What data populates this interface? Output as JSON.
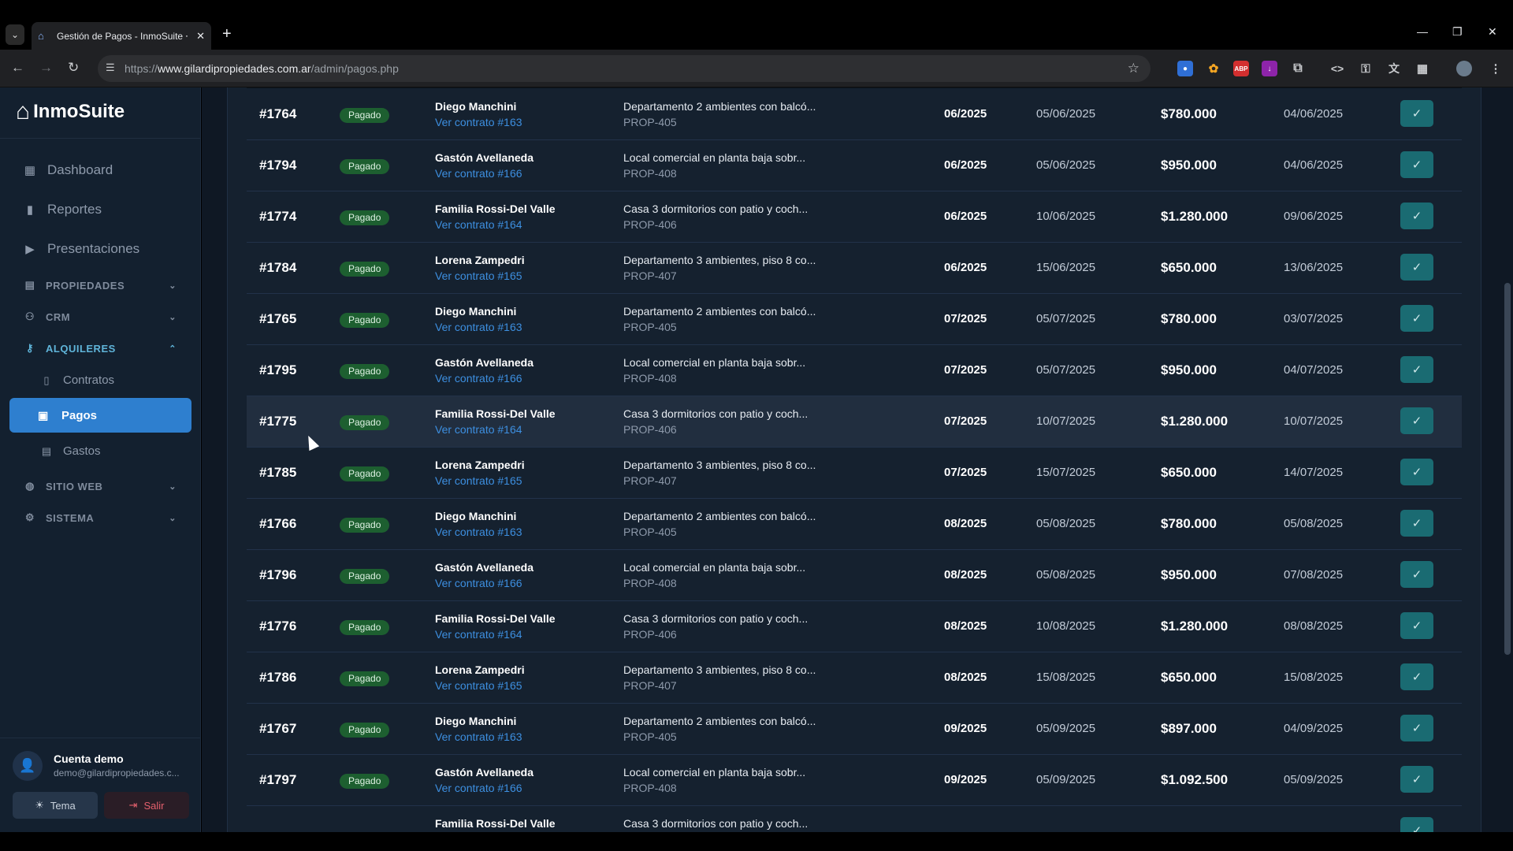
{
  "browser": {
    "tab_title": "Gestión de Pagos - InmoSuite ⸱",
    "url_scheme": "https://",
    "url_host": "www.gilardipropiedades.com.ar",
    "url_path": "/admin/pagos.php",
    "extensions": [
      "ABP"
    ]
  },
  "sidebar": {
    "brand": "InmoSuite",
    "nav": [
      {
        "label": "Dashboard",
        "icon": "grid-icon"
      },
      {
        "label": "Reportes",
        "icon": "bar-chart-icon"
      },
      {
        "label": "Presentaciones",
        "icon": "play-square-icon"
      }
    ],
    "groups": {
      "propiedades": "PROPIEDADES",
      "crm": "CRM",
      "alquileres": "ALQUILERES",
      "sitio_web": "SITIO WEB",
      "sistema": "SISTEMA"
    },
    "sub": {
      "contratos": "Contratos",
      "pagos": "Pagos",
      "gastos": "Gastos"
    },
    "user": {
      "name": "Cuenta demo",
      "email": "demo@gilardipropiedades.c..."
    },
    "buttons": {
      "tema": "Tema",
      "salir": "Salir"
    }
  },
  "payments": [
    {
      "id": "#1764",
      "status": "Pagado",
      "tenant": "Diego Manchini",
      "contract": "Ver contrato #163",
      "property": "Departamento 2 ambientes con balcó...",
      "code": "PROP-405",
      "period": "06/2025",
      "due": "05/06/2025",
      "amount": "$780.000",
      "paid": "04/06/2025"
    },
    {
      "id": "#1794",
      "status": "Pagado",
      "tenant": "Gastón Avellaneda",
      "contract": "Ver contrato #166",
      "property": "Local comercial en planta baja sobr...",
      "code": "PROP-408",
      "period": "06/2025",
      "due": "05/06/2025",
      "amount": "$950.000",
      "paid": "04/06/2025"
    },
    {
      "id": "#1774",
      "status": "Pagado",
      "tenant": "Familia Rossi-Del Valle",
      "contract": "Ver contrato #164",
      "property": "Casa 3 dormitorios con patio y coch...",
      "code": "PROP-406",
      "period": "06/2025",
      "due": "10/06/2025",
      "amount": "$1.280.000",
      "paid": "09/06/2025"
    },
    {
      "id": "#1784",
      "status": "Pagado",
      "tenant": "Lorena Zampedri",
      "contract": "Ver contrato #165",
      "property": "Departamento 3 ambientes, piso 8 co...",
      "code": "PROP-407",
      "period": "06/2025",
      "due": "15/06/2025",
      "amount": "$650.000",
      "paid": "13/06/2025"
    },
    {
      "id": "#1765",
      "status": "Pagado",
      "tenant": "Diego Manchini",
      "contract": "Ver contrato #163",
      "property": "Departamento 2 ambientes con balcó...",
      "code": "PROP-405",
      "period": "07/2025",
      "due": "05/07/2025",
      "amount": "$780.000",
      "paid": "03/07/2025"
    },
    {
      "id": "#1795",
      "status": "Pagado",
      "tenant": "Gastón Avellaneda",
      "contract": "Ver contrato #166",
      "property": "Local comercial en planta baja sobr...",
      "code": "PROP-408",
      "period": "07/2025",
      "due": "05/07/2025",
      "amount": "$950.000",
      "paid": "04/07/2025"
    },
    {
      "id": "#1775",
      "status": "Pagado",
      "tenant": "Familia Rossi-Del Valle",
      "contract": "Ver contrato #164",
      "property": "Casa 3 dormitorios con patio y coch...",
      "code": "PROP-406",
      "period": "07/2025",
      "due": "10/07/2025",
      "amount": "$1.280.000",
      "paid": "10/07/2025"
    },
    {
      "id": "#1785",
      "status": "Pagado",
      "tenant": "Lorena Zampedri",
      "contract": "Ver contrato #165",
      "property": "Departamento 3 ambientes, piso 8 co...",
      "code": "PROP-407",
      "period": "07/2025",
      "due": "15/07/2025",
      "amount": "$650.000",
      "paid": "14/07/2025"
    },
    {
      "id": "#1766",
      "status": "Pagado",
      "tenant": "Diego Manchini",
      "contract": "Ver contrato #163",
      "property": "Departamento 2 ambientes con balcó...",
      "code": "PROP-405",
      "period": "08/2025",
      "due": "05/08/2025",
      "amount": "$780.000",
      "paid": "05/08/2025"
    },
    {
      "id": "#1796",
      "status": "Pagado",
      "tenant": "Gastón Avellaneda",
      "contract": "Ver contrato #166",
      "property": "Local comercial en planta baja sobr...",
      "code": "PROP-408",
      "period": "08/2025",
      "due": "05/08/2025",
      "amount": "$950.000",
      "paid": "07/08/2025"
    },
    {
      "id": "#1776",
      "status": "Pagado",
      "tenant": "Familia Rossi-Del Valle",
      "contract": "Ver contrato #164",
      "property": "Casa 3 dormitorios con patio y coch...",
      "code": "PROP-406",
      "period": "08/2025",
      "due": "10/08/2025",
      "amount": "$1.280.000",
      "paid": "08/08/2025"
    },
    {
      "id": "#1786",
      "status": "Pagado",
      "tenant": "Lorena Zampedri",
      "contract": "Ver contrato #165",
      "property": "Departamento 3 ambientes, piso 8 co...",
      "code": "PROP-407",
      "period": "08/2025",
      "due": "15/08/2025",
      "amount": "$650.000",
      "paid": "15/08/2025"
    },
    {
      "id": "#1767",
      "status": "Pagado",
      "tenant": "Diego Manchini",
      "contract": "Ver contrato #163",
      "property": "Departamento 2 ambientes con balcó...",
      "code": "PROP-405",
      "period": "09/2025",
      "due": "05/09/2025",
      "amount": "$897.000",
      "paid": "04/09/2025"
    },
    {
      "id": "#1797",
      "status": "Pagado",
      "tenant": "Gastón Avellaneda",
      "contract": "Ver contrato #166",
      "property": "Local comercial en planta baja sobr...",
      "code": "PROP-408",
      "period": "09/2025",
      "due": "05/09/2025",
      "amount": "$1.092.500",
      "paid": "05/09/2025"
    },
    {
      "id": "",
      "status": "",
      "tenant": "Familia Rossi-Del Valle",
      "contract": "",
      "property": "Casa 3 dormitorios con patio y coch...",
      "code": "",
      "period": "",
      "due": "",
      "amount": "",
      "paid": ""
    }
  ]
}
